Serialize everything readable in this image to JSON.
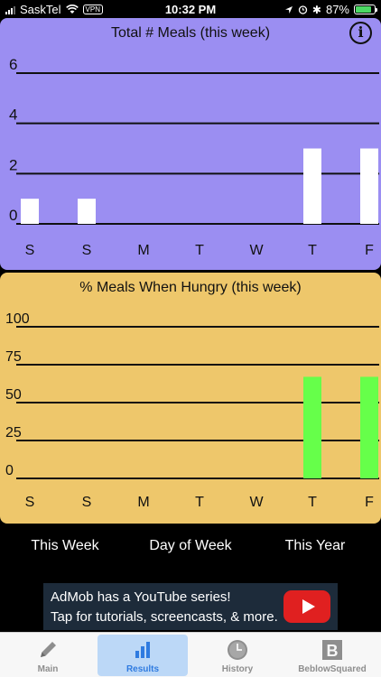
{
  "status_bar": {
    "carrier": "SaskTel",
    "vpn": "VPN",
    "time": "10:32 PM",
    "battery": "87%",
    "battery_level": 0.87
  },
  "colors": {
    "meals_panel": "#9b8ef2",
    "hungry_panel": "#eec76b",
    "meals_bar": "#ffffff",
    "hungry_bar": "#66ff4a",
    "tab_active": "#2f7be0"
  },
  "chart_data": [
    {
      "type": "bar",
      "title": "Total # Meals (this week)",
      "categories": [
        "S",
        "S",
        "M",
        "T",
        "W",
        "T",
        "F"
      ],
      "values": [
        1,
        1,
        0,
        0,
        0,
        3,
        3
      ],
      "yticks": [
        "6",
        "4",
        "2",
        "0"
      ],
      "ylim": [
        0,
        6
      ],
      "grid": true
    },
    {
      "type": "bar",
      "title": "% Meals When Hungry (this week)",
      "categories": [
        "S",
        "S",
        "M",
        "T",
        "W",
        "T",
        "F"
      ],
      "values": [
        0,
        0,
        0,
        0,
        0,
        67,
        67
      ],
      "yticks": [
        "100",
        "75",
        "50",
        "25",
        "0"
      ],
      "ylim": [
        0,
        100
      ],
      "grid": true
    }
  ],
  "segments": [
    "This Week",
    "Day of Week",
    "This Year"
  ],
  "ad": {
    "line1": "AdMob has a YouTube series!",
    "line2": "Tap for tutorials, screencasts, & more."
  },
  "tabs": [
    {
      "label": "Main",
      "icon": "pencil-icon"
    },
    {
      "label": "Results",
      "icon": "bar-chart-icon"
    },
    {
      "label": "History",
      "icon": "clock-icon"
    },
    {
      "label": "BeblowSquared",
      "icon": "b-logo-icon"
    }
  ]
}
